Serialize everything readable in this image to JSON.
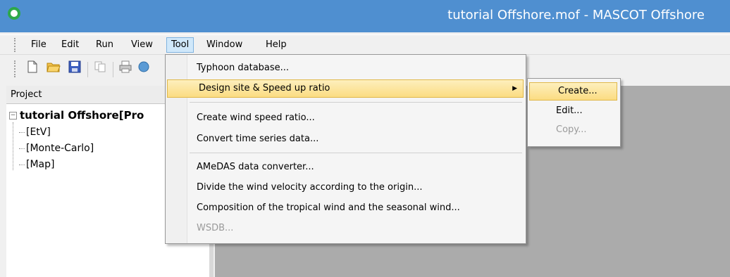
{
  "window": {
    "title": "tutorial Offshore.mof - MASCOT Offshore"
  },
  "menubar": {
    "items": [
      "File",
      "Edit",
      "Run",
      "View",
      "Tool",
      "Window",
      "Help"
    ],
    "active": "Tool"
  },
  "toolbar": {
    "icons": [
      "new-file-icon",
      "open-folder-icon",
      "save-icon",
      "copy-icon",
      "print-icon",
      "help-icon"
    ]
  },
  "project": {
    "header": "Project",
    "root": "tutorial Offshore[Pro",
    "children": [
      "[EtV]",
      "[Monte-Carlo]",
      "[Map]"
    ]
  },
  "tool_menu": {
    "items": [
      "Typhoon database...",
      "Design site & Speed up ratio",
      "Create wind speed ratio...",
      "Convert time series data...",
      "AMeDAS data converter...",
      "Divide the wind velocity according to the origin...",
      "Composition of the tropical wind and the seasonal wind...",
      "WSDB..."
    ]
  },
  "submenu": {
    "items": [
      "Create...",
      "Edit...",
      "Copy..."
    ]
  },
  "colors": {
    "titlebar": "#4f8fd0",
    "highlight": "#fbdc82",
    "workspace": "#ababab"
  }
}
